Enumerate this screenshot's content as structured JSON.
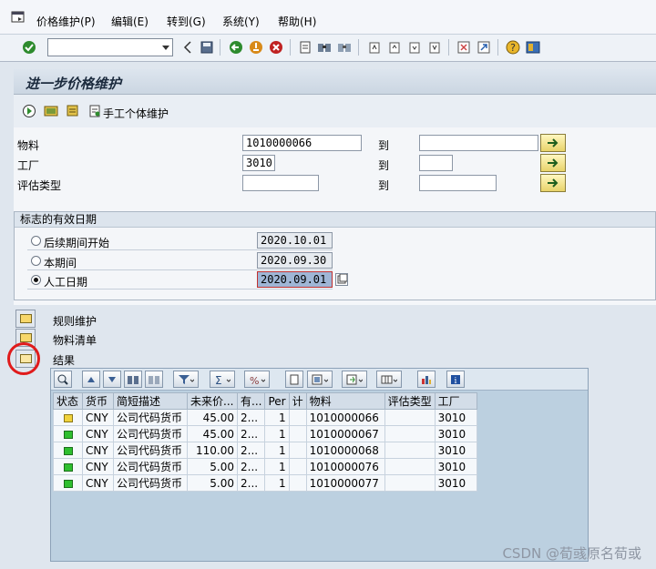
{
  "menu": [
    "价格维护(P)",
    "编辑(E)",
    "转到(G)",
    "系统(Y)",
    "帮助(H)"
  ],
  "command_field": "",
  "title": "进一步价格维护",
  "app_toolbar": {
    "manual_label": "手工个体维护"
  },
  "form": {
    "material_label": "物料",
    "material_from": "1010000066",
    "material_to": "",
    "plant_label": "工厂",
    "plant_from": "3010",
    "plant_to": "",
    "valuation_label": "评估类型",
    "valuation_from": "",
    "valuation_to": "",
    "to_label": "到"
  },
  "date_group": {
    "title": "标志的有效日期",
    "options": [
      {
        "label": "后续期间开始",
        "value": "2020.10.01",
        "selected": false
      },
      {
        "label": "本期间",
        "value": "2020.09.30",
        "selected": false
      },
      {
        "label": "人工日期",
        "value": "2020.09.01",
        "selected": true
      }
    ]
  },
  "tree": {
    "rules": "规则维护",
    "material_list": "物料清单",
    "results": "结果"
  },
  "grid": {
    "headers": [
      "状态",
      "货币",
      "简短描述",
      "未来价...",
      "有...",
      "Per",
      "计",
      "物料",
      "评估类型",
      "工厂"
    ],
    "rows": [
      {
        "status": "yellow",
        "currency": "CNY",
        "desc": "公司代码货币",
        "price": "45.00",
        "valid": "2...",
        "per": "1",
        "unit": "",
        "material": "1010000066",
        "valtype": "",
        "plant": "3010"
      },
      {
        "status": "green",
        "currency": "CNY",
        "desc": "公司代码货币",
        "price": "45.00",
        "valid": "2...",
        "per": "1",
        "unit": "",
        "material": "1010000067",
        "valtype": "",
        "plant": "3010"
      },
      {
        "status": "green",
        "currency": "CNY",
        "desc": "公司代码货币",
        "price": "110.00",
        "valid": "2...",
        "per": "1",
        "unit": "",
        "material": "1010000068",
        "valtype": "",
        "plant": "3010"
      },
      {
        "status": "green",
        "currency": "CNY",
        "desc": "公司代码货币",
        "price": "5.00",
        "valid": "2...",
        "per": "1",
        "unit": "",
        "material": "1010000076",
        "valtype": "",
        "plant": "3010"
      },
      {
        "status": "green",
        "currency": "CNY",
        "desc": "公司代码货币",
        "price": "5.00",
        "valid": "2...",
        "per": "1",
        "unit": "",
        "material": "1010000077",
        "valtype": "",
        "plant": "3010"
      }
    ]
  },
  "watermark": "CSDN @荀彧原名荀或",
  "colors": {
    "led_green": "#2fbf2f",
    "led_yellow": "#f0d23c",
    "highlight_circle": "#e01b1b"
  }
}
